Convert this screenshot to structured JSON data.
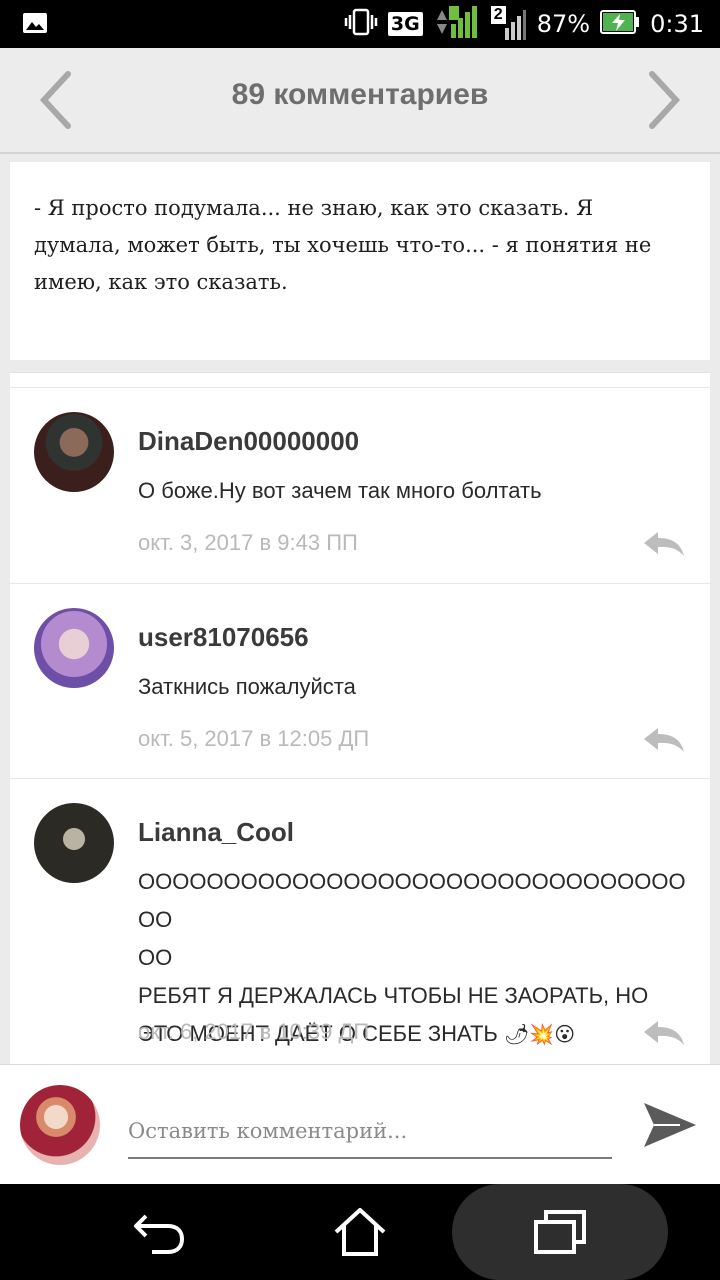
{
  "status_bar": {
    "network": "3G",
    "sim_number": "2",
    "battery": "87%",
    "time": "0:31"
  },
  "header": {
    "title": "89 комментариев"
  },
  "story": {
    "text": "- Я просто подумала... не знаю, как это сказать. Я думала, может быть, ты хочешь что-то... - я понятия не имею, как это сказать."
  },
  "comments": [
    {
      "username": "DinaDen00000000",
      "lines": [
        "О боже.Ну вот зачем так много болтать"
      ],
      "date": "окт. 3, 2017 в 9:43 ПП"
    },
    {
      "username": "user81070656",
      "lines": [
        "Заткнись пожалуйста"
      ],
      "date": "окт. 5, 2017 в 12:05 ДП"
    },
    {
      "username": "Lianna_Cool",
      "lines": [
        "ОООООООООООООООООООООООООООООООООО",
        "ОО",
        "РЕБЯТ Я ДЕРЖАЛАСЬ ЧТОБЫ НЕ ЗАОРАТЬ, НО",
        "ЭТО МОЕНТ ДАЁТ О СЕБЕ ЗНАТЬ"
      ],
      "emoji": "🌶💥😮",
      "date": "окт. 6, 2017 в 10:39 ДП"
    }
  ],
  "composer": {
    "placeholder": "Оставить комментарий..."
  }
}
